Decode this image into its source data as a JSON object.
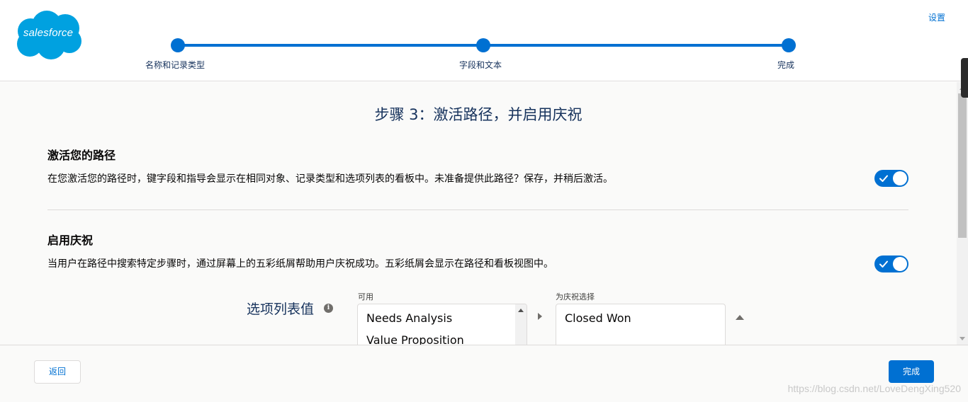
{
  "header": {
    "logo_text": "salesforce",
    "settings_link": "设置",
    "steps": [
      {
        "label": "名称和记录类型"
      },
      {
        "label": "字段和文本"
      },
      {
        "label": "完成"
      }
    ]
  },
  "main": {
    "title": "步骤 3：激活路径，并启用庆祝",
    "activate_section": {
      "heading": "激活您的路径",
      "description": "在您激活您的路径时，键字段和指导会显示在相同对象、记录类型和选项列表的看板中。未准备提供此路径？保存，并稍后激活。",
      "toggle_on": true
    },
    "celebration_section": {
      "heading": "启用庆祝",
      "description": "当用户在路径中搜索特定步骤时，通过屏幕上的五彩纸屑帮助用户庆祝成功。五彩纸屑会显示在路径和看板视图中。",
      "toggle_on": true
    },
    "picklist": {
      "label": "选项列表值",
      "available_caption": "可用",
      "available_items": [
        "Needs Analysis",
        "Value Proposition"
      ],
      "selected_caption": "为庆祝选择",
      "selected_items": [
        "Closed Won"
      ]
    }
  },
  "footer": {
    "back_label": "返回",
    "finish_label": "完成",
    "watermark": "https://blog.csdn.net/LoveDengXing520"
  },
  "colors": {
    "brand_blue": "#0070d2",
    "logo_blue": "#00a1e0",
    "text_dark": "#16325c"
  },
  "icons": [
    "salesforce-logo",
    "check-icon",
    "info-icon",
    "chevron-right-icon",
    "chevron-up-icon"
  ]
}
